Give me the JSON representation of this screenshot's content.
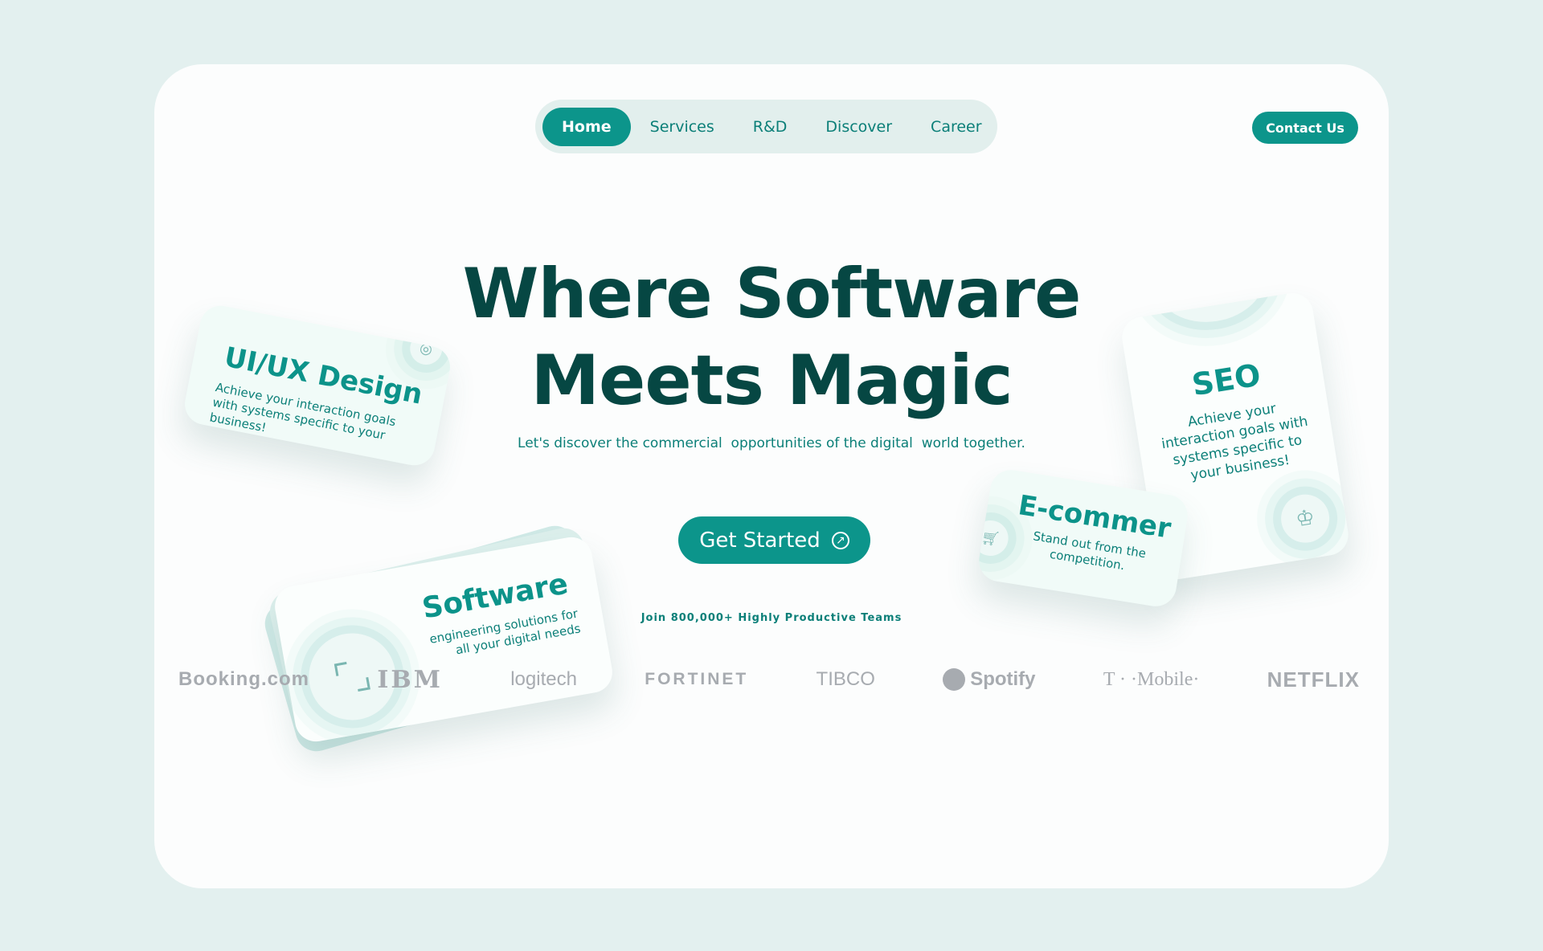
{
  "nav": {
    "items": [
      {
        "label": "Home",
        "active": true
      },
      {
        "label": "Services",
        "active": false
      },
      {
        "label": "R&D",
        "active": false
      },
      {
        "label": "Discover",
        "active": false
      },
      {
        "label": "Career",
        "active": false
      }
    ],
    "contact_label": "Contact Us"
  },
  "hero": {
    "title_line1": "Where Software",
    "title_line2": "Meets Magic",
    "subtitle": "Let's discover the commercial  opportunities of the digital  world together.",
    "cta_label": "Get Started",
    "cta_icon": "arrow-up-right-circle-icon"
  },
  "cards": {
    "uiux": {
      "title": "UI/UX Design",
      "desc": "Achieve your interaction goals with systems specific to your business!",
      "icon": "design-icon"
    },
    "software": {
      "title": "Software",
      "desc": "engineering solutions for all your digital needs",
      "icon": "expand-icon"
    },
    "seo": {
      "title": "SEO",
      "desc": "Achieve your interaction goals with systems specific to your business!",
      "icon": "crown-search-icon"
    },
    "ecommerce": {
      "title": "E-commer",
      "desc": "Stand out from the competition.",
      "icon": "cart-icon"
    }
  },
  "social_proof": {
    "text": "Join 800,000+ Highly Productive Teams",
    "logos": [
      "Booking.com",
      "IBM",
      "logitech",
      "FORTINET",
      "TIBCO",
      "Spotify",
      "T · ·Mobile·",
      "NETFLIX"
    ]
  },
  "colors": {
    "accent": "#0c958b",
    "heading": "#064743",
    "background": "#e3f0ef"
  }
}
